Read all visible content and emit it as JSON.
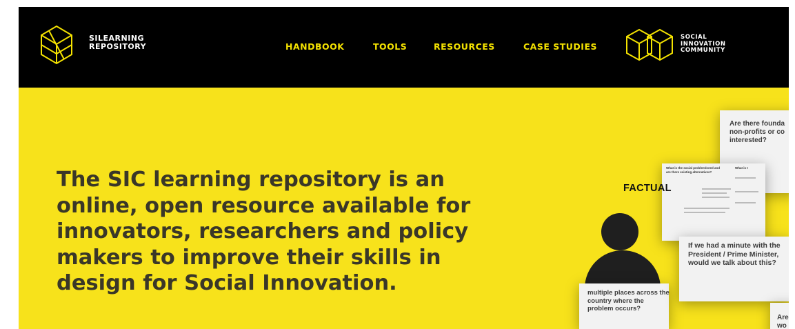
{
  "header": {
    "brand_left_line1": "SILEARNING",
    "brand_left_line2": "REPOSITORY",
    "nav": [
      "HANDBOOK",
      "TOOLS",
      "RESOURCES",
      "CASE STUDIES"
    ],
    "brand_right_line1": "SOCIAL",
    "brand_right_line2": "INNOVATION",
    "brand_right_line3": "COMMUNITY"
  },
  "hero": {
    "headline": "The SIC learning repository is an online, open resource available for innovators, researchers and policy makers to improve their skills in design for Social Innovation."
  },
  "collage": {
    "card_top": "Are there founda non-profits or co interested?",
    "factual": "FACTUAL",
    "card_question": "If we had a minute with the President / Prime Minister, would we talk about this?",
    "card_bottom_left": "multiple places across the country where the problem occurs?",
    "card_bottom_right": "Are wo",
    "doc_heading": "What is the social problem/need and are there existing alternatives?",
    "doc_heading_right": "What is t"
  },
  "colors": {
    "header_bg": "#000000",
    "accent_yellow": "#f7e21b",
    "nav_text": "#f4e200",
    "hero_text": "#3a3728"
  }
}
